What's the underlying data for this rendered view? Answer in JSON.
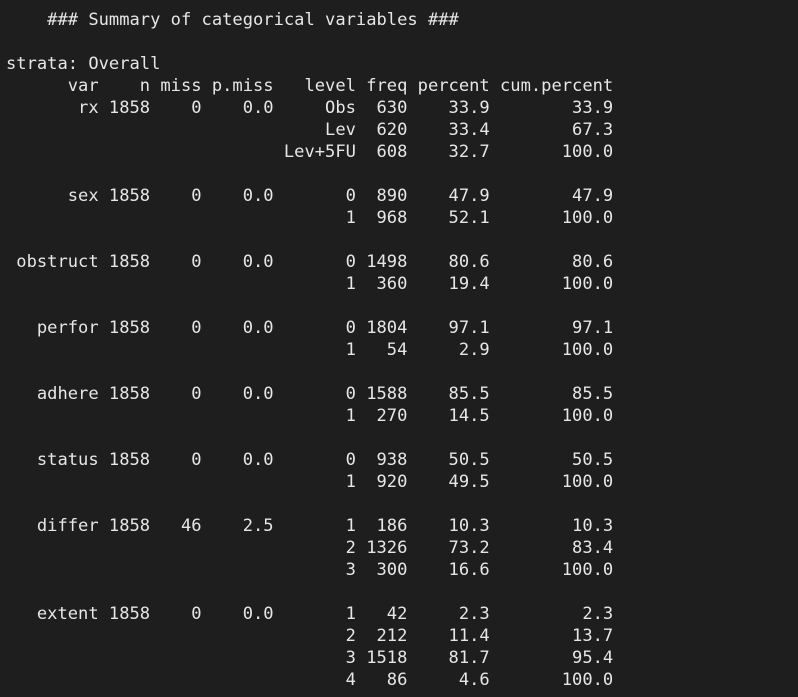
{
  "console": {
    "lines": [
      "    ### Summary of categorical variables ###",
      "",
      "strata: Overall",
      "      var    n miss p.miss   level freq percent cum.percent",
      "       rx 1858    0    0.0     Obs  630    33.9        33.9",
      "                               Lev  620    33.4        67.3",
      "                           Lev+5FU  608    32.7       100.0",
      "",
      "      sex 1858    0    0.0       0  890    47.9        47.9",
      "                                 1  968    52.1       100.0",
      "",
      " obstruct 1858    0    0.0       0 1498    80.6        80.6",
      "                                 1  360    19.4       100.0",
      "",
      "   perfor 1858    0    0.0       0 1804    97.1        97.1",
      "                                 1   54     2.9       100.0",
      "",
      "   adhere 1858    0    0.0       0 1588    85.5        85.5",
      "                                 1  270    14.5       100.0",
      "",
      "   status 1858    0    0.0       0  938    50.5        50.5",
      "                                 1  920    49.5       100.0",
      "",
      "   differ 1858   46    2.5       1  186    10.3        10.3",
      "                                 2 1326    73.2        83.4",
      "                                 3  300    16.6       100.0",
      "",
      "   extent 1858    0    0.0       1   42     2.3         2.3",
      "                                 2  212    11.4        13.7",
      "                                 3 1518    81.7        95.4",
      "                                 4   86     4.6       100.0"
    ]
  }
}
